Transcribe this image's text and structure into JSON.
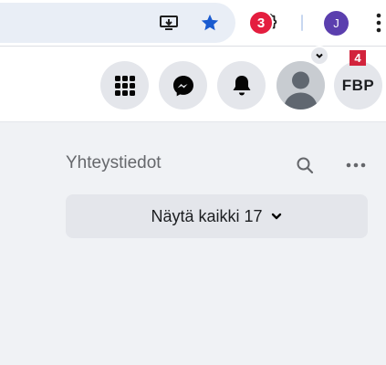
{
  "browser": {
    "profile_initial": "J",
    "icons": {
      "install": "install-app-icon",
      "bookmark": "star-icon",
      "extensions": "puzzle-icon",
      "menu": "kebab-icon"
    },
    "accent": "#1a5bd0",
    "profile_color": "#5b3fae"
  },
  "header": {
    "notifications_count": "3",
    "page_short_name": "FBP",
    "page_badge_count": "4",
    "icons": {
      "menu": "grid-icon",
      "messenger": "messenger-icon",
      "notifications": "bell-icon",
      "account": "avatar",
      "account_dropdown": "chevron-down-icon"
    },
    "badge_color": "#e41e3f"
  },
  "contacts": {
    "title": "Yhteystiedot",
    "show_all_label": "Näytä kaikki 17",
    "icons": {
      "search": "search-icon",
      "more": "more-icon",
      "expand": "chevron-down-icon"
    }
  }
}
